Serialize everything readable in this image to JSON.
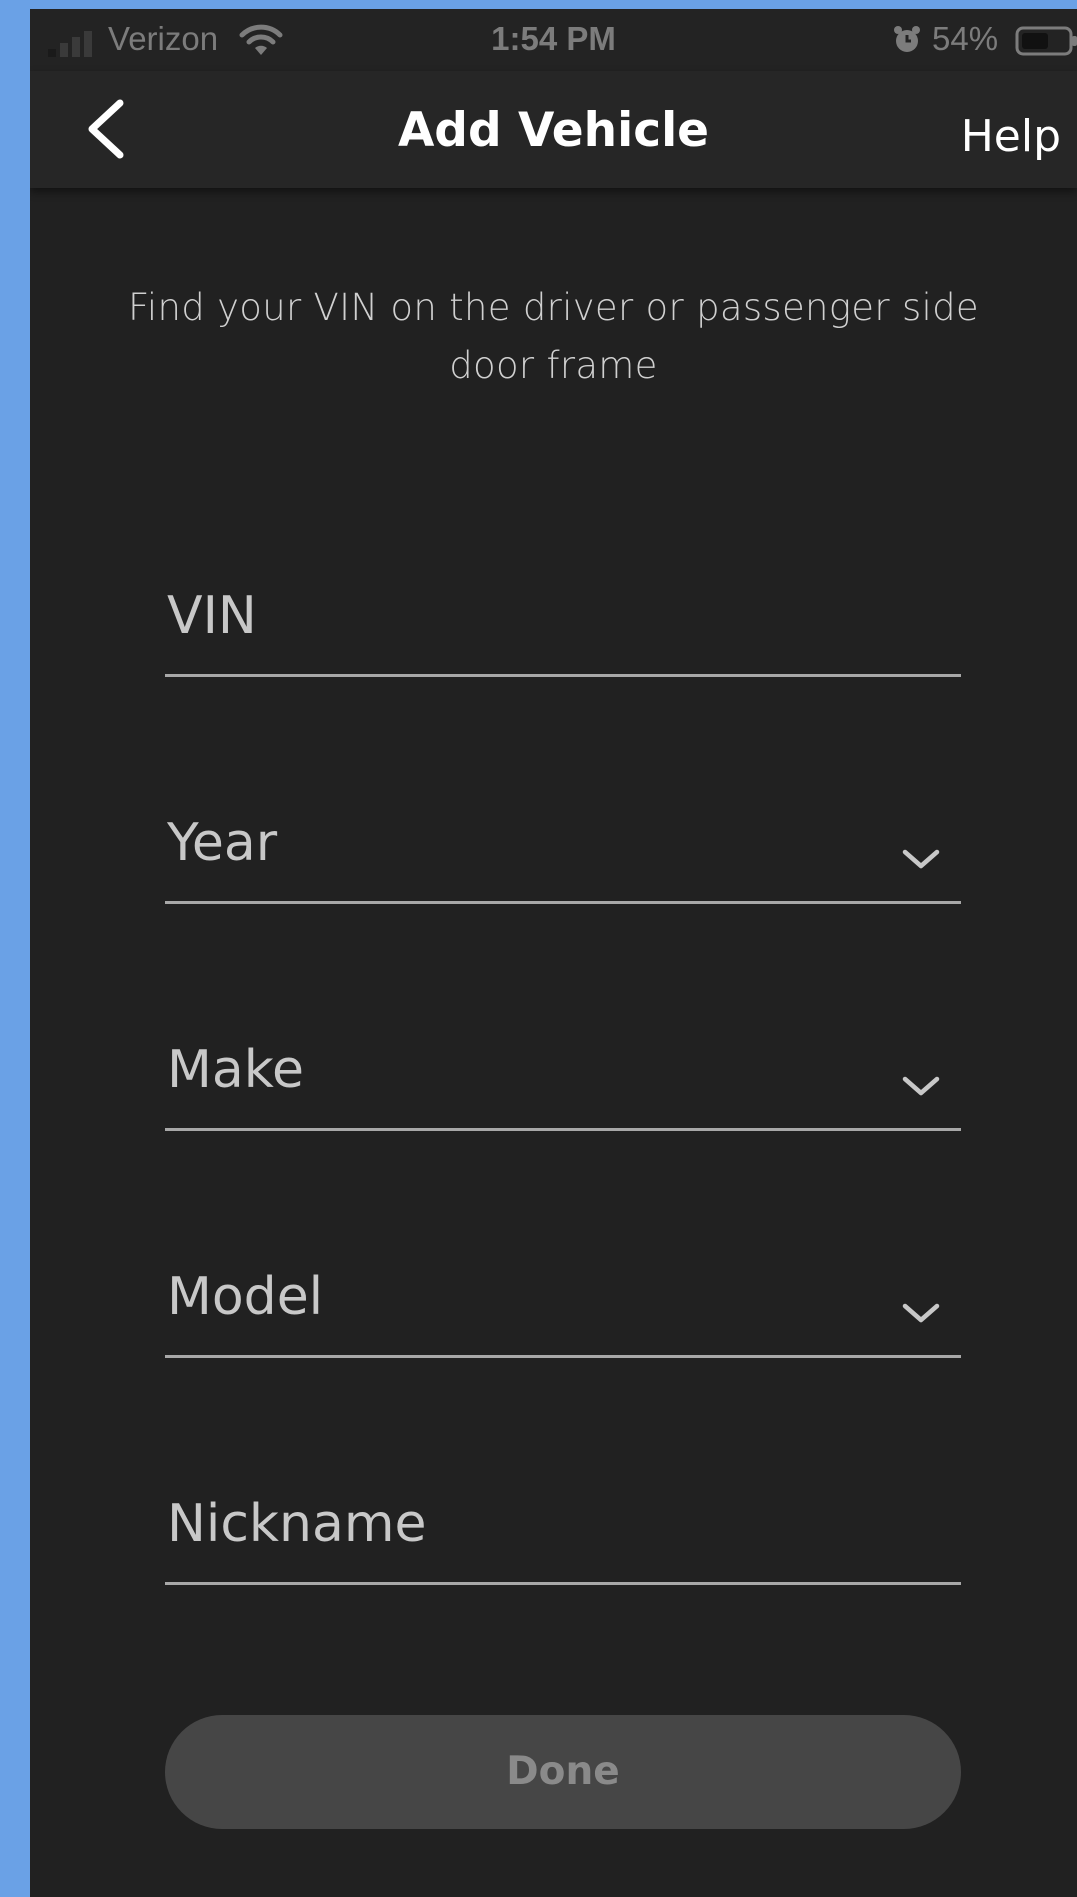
{
  "status_bar": {
    "carrier": "Verizon",
    "time": "1:54 PM",
    "battery_percent": "54%",
    "icons": [
      "signal-icon",
      "wifi-icon",
      "alarm-icon",
      "battery-icon"
    ]
  },
  "nav": {
    "back_icon": "chevron-left-icon",
    "title": "Add Vehicle",
    "help_label": "Help"
  },
  "instruction": "Find your VIN on the driver or passenger side door frame",
  "form": {
    "fields": [
      {
        "label": "VIN",
        "type": "text"
      },
      {
        "label": "Year",
        "type": "select",
        "icon": "chevron-down-icon"
      },
      {
        "label": "Make",
        "type": "select",
        "icon": "chevron-down-icon"
      },
      {
        "label": "Model",
        "type": "select",
        "icon": "chevron-down-icon"
      },
      {
        "label": "Nickname",
        "type": "text"
      }
    ],
    "done_label": "Done"
  },
  "colors": {
    "background": "#212121",
    "nav_background": "#262626",
    "underline": "#a8a8a8",
    "button_disabled": "#464646",
    "button_text_disabled": "#8a8a8a",
    "outer_frame": "#6aa1e6"
  }
}
